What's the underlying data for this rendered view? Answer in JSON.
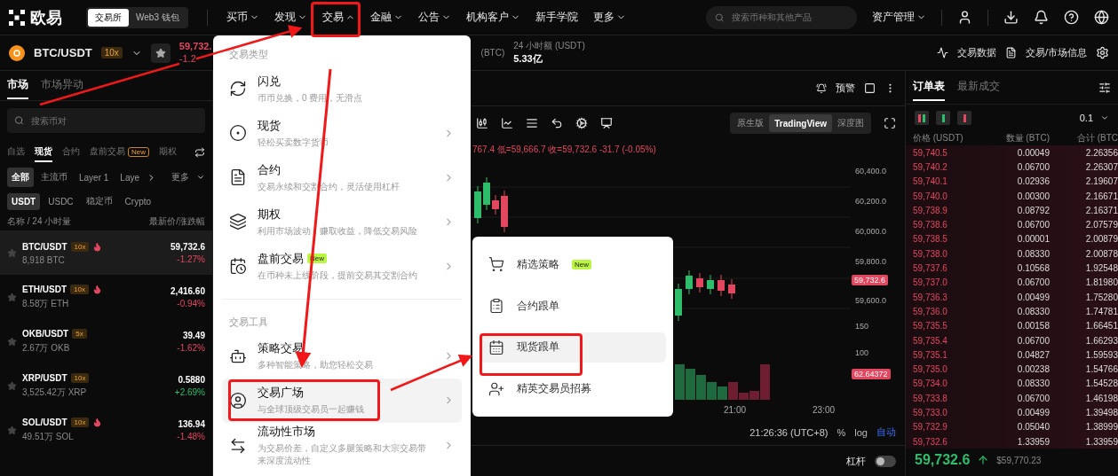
{
  "nav": {
    "logo": "欧易",
    "modes": [
      {
        "label": "交易所",
        "selected": true
      },
      {
        "label": "Web3 钱包",
        "selected": false
      }
    ],
    "menu": [
      {
        "label": "买币",
        "open": false
      },
      {
        "label": "发现",
        "open": false
      },
      {
        "label": "交易",
        "open": true
      },
      {
        "label": "金融",
        "open": false
      },
      {
        "label": "公告",
        "open": false
      },
      {
        "label": "机构客户",
        "open": false
      },
      {
        "label": "新手学院"
      },
      {
        "label": "更多",
        "open": false
      }
    ],
    "search": {
      "placeholder": "搜索币种和其他产品"
    },
    "account": "资产管理"
  },
  "ticker": {
    "pair": "BTC/USDT",
    "leverage": "10x",
    "price": "59,732.",
    "change": "-1.2",
    "volume_label": "(BTC)",
    "turnover_label": "24 小时额 (USDT)",
    "turnover": "5.33亿",
    "links": [
      "交易数据",
      "交易/市场信息"
    ]
  },
  "market": {
    "tabs": [
      {
        "label": "市场",
        "selected": true
      },
      {
        "label": "市场异动",
        "selected": false
      }
    ],
    "search": {
      "placeholder": "搜索币对"
    },
    "categories": [
      {
        "label": "自选",
        "selected": false
      },
      {
        "label": "现货",
        "selected": true
      },
      {
        "label": "合约",
        "selected": false
      },
      {
        "label": "盘前交易",
        "badge": "New",
        "selected": false
      },
      {
        "label": "期权",
        "selected": false
      }
    ],
    "sectors": [
      {
        "label": "全部",
        "selected": true
      },
      {
        "label": "主流币",
        "selected": false
      },
      {
        "label": "Layer 1",
        "selected": false
      },
      {
        "label": "Laye",
        "selected": false
      }
    ],
    "more": "更多",
    "quotes": [
      {
        "label": "USDT",
        "selected": true
      },
      {
        "label": "USDC",
        "selected": false
      },
      {
        "label": "稳定币",
        "selected": false
      },
      {
        "label": "Crypto",
        "selected": false
      }
    ],
    "columns": [
      "名称 / 24 小时量",
      "最新价/涨跌幅"
    ],
    "rows": [
      {
        "pair": "BTC/USDT",
        "leverage": "10x",
        "hot": true,
        "volume": "8,918 BTC",
        "price": "59,732.6",
        "change": "-1.27%",
        "rising": false,
        "selected": true
      },
      {
        "pair": "ETH/USDT",
        "leverage": "10x",
        "hot": true,
        "volume": "8.58万 ETH",
        "price": "2,416.60",
        "change": "-0.94%",
        "rising": false,
        "selected": false
      },
      {
        "pair": "OKB/USDT",
        "leverage": "5x",
        "hot": false,
        "volume": "2.67万 OKB",
        "price": "39.49",
        "change": "-1.62%",
        "rising": false,
        "selected": false
      },
      {
        "pair": "XRP/USDT",
        "leverage": "10x",
        "hot": false,
        "volume": "3,525.42万 XRP",
        "price": "0.5880",
        "change": "+2.69%",
        "rising": true,
        "selected": false
      },
      {
        "pair": "SOL/USDT",
        "leverage": "10x",
        "hot": true,
        "volume": "49.51万 SOL",
        "price": "136.94",
        "change": "-1.48%",
        "rising": false,
        "selected": false
      }
    ]
  },
  "trade_menu": {
    "sections": [
      {
        "title": "交易类型",
        "items": [
          {
            "kind": "swap",
            "label": "闪兑",
            "description": "币币兑换，0 费用，无滑点",
            "has_submenu": false,
            "selected": false
          },
          {
            "kind": "spot",
            "label": "现货",
            "description": "轻松买卖数字货币",
            "has_submenu": true,
            "selected": false
          },
          {
            "kind": "contract",
            "label": "合约",
            "description": "交易永续和交割合约，灵活使用杠杆",
            "has_submenu": true,
            "selected": false
          },
          {
            "kind": "options",
            "label": "期权",
            "description": "利用市场波动，赚取收益，降低交易风险",
            "has_submenu": true,
            "selected": false
          },
          {
            "kind": "premarket",
            "label": "盘前交易",
            "badge": "New",
            "description": "在币种未上线阶段，提前交易其交割合约",
            "has_submenu": true,
            "selected": false
          }
        ]
      },
      {
        "title": "交易工具",
        "items": [
          {
            "kind": "bot",
            "label": "策略交易",
            "description": "多种智能策略，助您轻松交易",
            "has_submenu": true,
            "selected": false
          },
          {
            "kind": "copy",
            "label": "交易广场",
            "description": "与全球顶级交易员一起赚钱",
            "has_submenu": true,
            "selected": true
          },
          {
            "kind": "liquidity",
            "label": "流动性市场",
            "description": "为交易价差，自定义多腿策略和大宗交易带来深度流动性",
            "has_submenu": true,
            "selected": false
          }
        ]
      }
    ]
  },
  "submenu": {
    "items": [
      {
        "kind": "strategy",
        "label": "精选策略",
        "badge": "New",
        "selected": false
      },
      {
        "kind": "futures",
        "label": "合约跟单",
        "selected": false
      },
      {
        "kind": "spot",
        "label": "现货跟单",
        "selected": true
      },
      {
        "kind": "recruit",
        "label": "精英交易员招募",
        "selected": false
      }
    ]
  },
  "chart": {
    "alert": "预警",
    "views": [
      {
        "label": "原生版",
        "selected": false
      },
      {
        "label": "TradingView",
        "selected": true
      },
      {
        "label": "深度图",
        "selected": false
      }
    ],
    "ohlc": "767.4 低=59,666.7 收=59,732.6 -31.7 (-0.05%)",
    "price_axis": [
      "60,400.0",
      "60,200.0",
      "60,000.0",
      "59,800.0",
      "59,600.0"
    ],
    "last_price": "59,732.6",
    "volume_axis": [
      "150",
      "100"
    ],
    "volume_last": "62.64372",
    "time_axis": [
      "21:00",
      "23:00"
    ],
    "clock": "21:26:36 (UTC+8)",
    "scale_options": [
      {
        "label": "%",
        "selected": false
      },
      {
        "label": "log",
        "selected": false
      },
      {
        "label": "自动",
        "selected": true
      }
    ],
    "leverage_label": "杠杆",
    "leverage_on": false
  },
  "order_book": {
    "tabs": [
      {
        "label": "订单表",
        "selected": true
      },
      {
        "label": "最新成交",
        "selected": false
      }
    ],
    "tick_size": "0.1",
    "columns": [
      "价格 (USDT)",
      "数量 (BTC)",
      "合计 (BTC"
    ],
    "asks": [
      {
        "price": "59,740.5",
        "amount": "0.00049",
        "total": "2.26356"
      },
      {
        "price": "59,740.2",
        "amount": "0.06700",
        "total": "2.26307"
      },
      {
        "price": "59,740.1",
        "amount": "0.02936",
        "total": "2.19607"
      },
      {
        "price": "59,740.0",
        "amount": "0.00300",
        "total": "2.16671"
      },
      {
        "price": "59,738.9",
        "amount": "0.08792",
        "total": "2.16371"
      },
      {
        "price": "59,738.6",
        "amount": "0.06700",
        "total": "2.07579"
      },
      {
        "price": "59,738.5",
        "amount": "0.00001",
        "total": "2.00879"
      },
      {
        "price": "59,738.0",
        "amount": "0.08330",
        "total": "2.00878"
      },
      {
        "price": "59,737.6",
        "amount": "0.10568",
        "total": "1.92548"
      },
      {
        "price": "59,737.0",
        "amount": "0.06700",
        "total": "1.81980"
      },
      {
        "price": "59,736.3",
        "amount": "0.00499",
        "total": "1.75280"
      },
      {
        "price": "59,736.0",
        "amount": "0.08330",
        "total": "1.74781"
      },
      {
        "price": "59,735.5",
        "amount": "0.00158",
        "total": "1.66451"
      },
      {
        "price": "59,735.4",
        "amount": "0.06700",
        "total": "1.66293"
      },
      {
        "price": "59,735.1",
        "amount": "0.04827",
        "total": "1.59593"
      },
      {
        "price": "59,735.0",
        "amount": "0.00238",
        "total": "1.54766"
      },
      {
        "price": "59,734.0",
        "amount": "0.08330",
        "total": "1.54528"
      },
      {
        "price": "59,733.8",
        "amount": "0.06700",
        "total": "1.46198"
      },
      {
        "price": "59,733.0",
        "amount": "0.00499",
        "total": "1.39498"
      },
      {
        "price": "59,732.9",
        "amount": "0.05040",
        "total": "1.38999"
      },
      {
        "price": "59,732.6",
        "amount": "1.33959",
        "total": "1.33959"
      }
    ],
    "last_price": "59,732.6",
    "last_rising": true,
    "index_price": "$59,770.23"
  }
}
